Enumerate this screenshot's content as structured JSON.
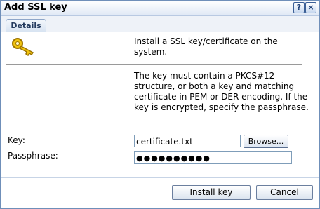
{
  "window": {
    "title": "Add SSL key",
    "help_label": "?",
    "close_label": "×"
  },
  "tabs": [
    {
      "label": "Details"
    }
  ],
  "content": {
    "intro": "Install a SSL key/certificate on the system.",
    "description": "The key must contain a PKCS#12 structure, or both a key and matching certificate in PEM or DER encoding. If the key is encrypted, specify the passphrase.",
    "key_label": "Key:",
    "key_value": "certificate.txt",
    "browse_label": "Browse...",
    "passphrase_label": "Passphrase:",
    "passphrase_value": "●●●●●●●●●●"
  },
  "footer": {
    "install_label": "Install key",
    "cancel_label": "Cancel"
  },
  "colors": {
    "border": "#6f8fb9",
    "icon": "#e6b800"
  },
  "icons": {
    "key": "key-icon",
    "help": "question-icon",
    "close": "close-icon"
  }
}
